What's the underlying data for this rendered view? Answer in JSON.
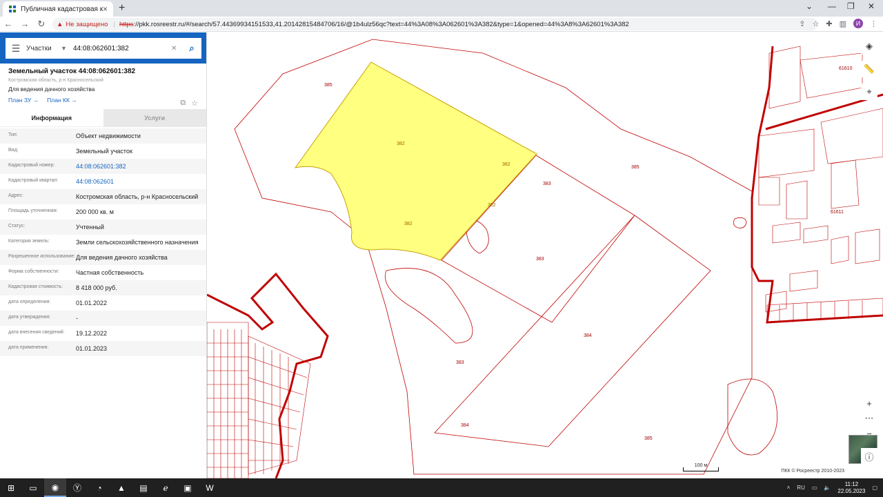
{
  "browser": {
    "tab_title": "Публичная кадастровая карта",
    "insecure_label": "Не защищено",
    "url_scheme": "https",
    "url_rest": "://pkk.rosreestr.ru/#/search/57.44369934151533,41.20142815484706/16/@1b4ulz56qc?text=44%3A08%3A062601%3A382&type=1&opened=44%3A8%3A62601%3A382",
    "profile_initial": "И"
  },
  "search": {
    "type_label": "Участки",
    "value": "44:08:062601:382"
  },
  "card": {
    "title": "Земельный участок 44:08:062601:382",
    "address_small": "Костромская область, р-н Красносельский",
    "use": "Для ведения дачного хозяйства",
    "plan_zu": "План ЗУ →",
    "plan_kk": "План КК →"
  },
  "tabs": {
    "info": "Информация",
    "services": "Услуги"
  },
  "rows": [
    {
      "label": "Тип:",
      "value": "Объект недвижимости"
    },
    {
      "label": "Вид:",
      "value": "Земельный участок"
    },
    {
      "label": "Кадастровый номер:",
      "value": "44:08:062601:382",
      "link": true
    },
    {
      "label": "Кадастровый квартал:",
      "value": "44:08:062601",
      "link": true
    },
    {
      "label": "Адрес:",
      "value": "Костромская область, р-н Красносельский"
    },
    {
      "label": "Площадь уточненная:",
      "value": "200 000 кв. м"
    },
    {
      "label": "Статус:",
      "value": "Учтенный"
    },
    {
      "label": "Категория земель:",
      "value": "Земли сельскохозяйственного назначения"
    },
    {
      "label": "Разрешенное использование:",
      "value": "Для ведения дачного хозяйства"
    },
    {
      "label": "Форма собственности:",
      "value": "Частная собственность"
    },
    {
      "label": "Кадастровая стоимость:",
      "value": "8 418 000 руб."
    },
    {
      "label": "дата определения:",
      "value": "01.01.2022"
    },
    {
      "label": "дата утверждения:",
      "value": "-"
    },
    {
      "label": "дата внесения сведений:",
      "value": "19.12.2022"
    },
    {
      "label": "дата применения:",
      "value": "01.01.2023"
    }
  ],
  "map": {
    "labels": {
      "p385a": "385",
      "p382a": "382",
      "p382b": "382",
      "p382c": "382",
      "p382d": "382",
      "p385b": "385",
      "p383a": "383",
      "p383b": "383",
      "p384a": "384",
      "p383c": "383",
      "p384b": "384",
      "p385c": "385",
      "q61610": "61610",
      "q61611": "61611"
    },
    "scale": "100 м",
    "copyright": "ПКК © Росреестр 2010-2023",
    "highlight_color": "#ffff80",
    "border_color": "#c00000"
  },
  "taskbar": {
    "lang": "RU",
    "time": "11:12",
    "date": "22.05.2023"
  }
}
